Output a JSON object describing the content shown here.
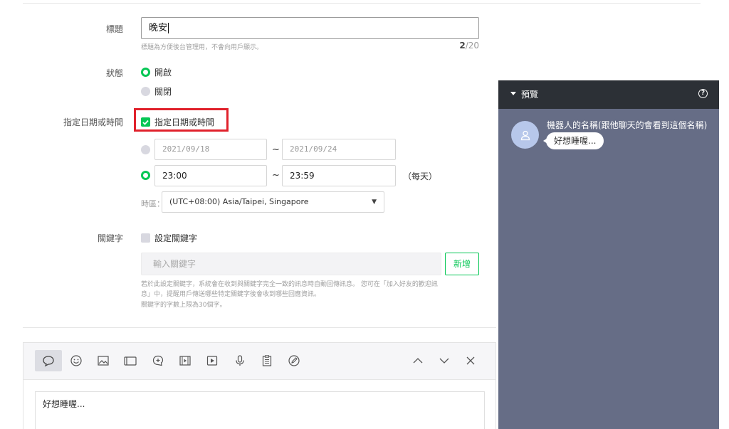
{
  "form": {
    "title_label": "標題",
    "title_value": "晚安",
    "title_hint": "標題為方便後台管理用，不會向用戶顯示。",
    "title_count": "2",
    "title_max": "/20",
    "status_label": "狀態",
    "status_options": [
      {
        "label": "開啟",
        "selected": true
      },
      {
        "label": "關閉",
        "selected": false
      }
    ],
    "date_label": "指定日期或時間",
    "date_checkbox_label": "指定日期或時間",
    "date_start": "2021/09/18",
    "date_end": "2021/09/24",
    "range_sep": "~",
    "time_start": "23:00",
    "time_end": "23:59",
    "time_suffix": "（每天）",
    "timezone_label": "時區：",
    "timezone_value": "(UTC+08:00) Asia/Taipei, Singapore",
    "keyword_label": "關鍵字",
    "keyword_checkbox_label": "設定關鍵字",
    "keyword_placeholder": "輸入關鍵字",
    "keyword_add": "新增",
    "keyword_hint_1": "若於此設定關鍵字，系統會在收到與關鍵字完全一致的訊息時自動回傳訊息。 您可在「加入好友的歡迎訊",
    "keyword_hint_2": "息」中，提醒用戶傳送哪些特定關鍵字後會收到哪些回應資訊。",
    "keyword_hint_3": "關鍵字的字數上限為30個字。"
  },
  "editor": {
    "message_text": "好想睡喔..."
  },
  "preview": {
    "title": "預覽",
    "help": "?",
    "bot_name": "機器人的名稱(跟他聊天的會看到這個名稱)",
    "bubble_text": "好想睡喔..."
  },
  "colors": {
    "accent": "#06c755",
    "highlight": "#e0212b",
    "preview_bg": "#666d86",
    "preview_header": "#2c3036"
  }
}
